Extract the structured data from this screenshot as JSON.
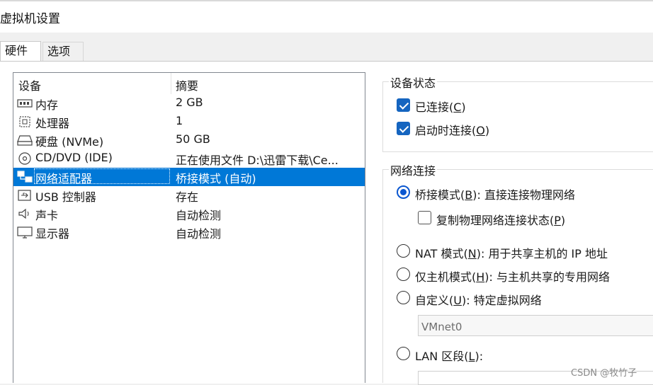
{
  "window": {
    "title": "虚拟机设置"
  },
  "tabs": [
    {
      "label": "硬件"
    },
    {
      "label": "选项"
    }
  ],
  "device_list": {
    "headers": {
      "device": "设备",
      "summary": "摘要"
    },
    "rows": [
      {
        "icon": "memory-icon",
        "name": "内存",
        "summary": "2 GB"
      },
      {
        "icon": "processor-icon",
        "name": "处理器",
        "summary": "1"
      },
      {
        "icon": "hard-disk-icon",
        "name": "硬盘 (NVMe)",
        "summary": "50 GB"
      },
      {
        "icon": "cd-dvd-icon",
        "name": "CD/DVD (IDE)",
        "summary": "正在使用文件 D:\\迅雷下载\\Ce..."
      },
      {
        "icon": "network-adapter-icon",
        "name": "网络适配器",
        "summary": "桥接模式 (自动)",
        "selected": true
      },
      {
        "icon": "usb-icon",
        "name": "USB 控制器",
        "summary": "存在"
      },
      {
        "icon": "sound-icon",
        "name": "声卡",
        "summary": "自动检测"
      },
      {
        "icon": "display-icon",
        "name": "显示器",
        "summary": "自动检测"
      }
    ]
  },
  "device_status": {
    "title": "设备状态",
    "connected": {
      "label_pre": "已连接(",
      "key": "C",
      "label_post": ")",
      "checked": true
    },
    "connect_at_power_on": {
      "label_pre": "启动时连接(",
      "key": "O",
      "label_post": ")",
      "checked": true
    }
  },
  "network_connection": {
    "title": "网络连接",
    "bridged": {
      "label_pre": "桥接模式(",
      "key": "B",
      "label_post": "): 直接连接物理网络",
      "selected": true
    },
    "replicate": {
      "label_pre": "复制物理网络连接状态(",
      "key": "P",
      "label_post": ")",
      "checked": false
    },
    "nat": {
      "label_pre": "NAT 模式(",
      "key": "N",
      "label_post": "): 用于共享主机的 IP 地址",
      "selected": false
    },
    "host_only": {
      "label_pre": "仅主机模式(",
      "key": "H",
      "label_post": "): 与主机共享的专用网络",
      "selected": false
    },
    "custom": {
      "label_pre": "自定义(",
      "key": "U",
      "label_post": "): 特定虚拟网络",
      "selected": false
    },
    "custom_network_value": "VMnet0",
    "lan_segment": {
      "label_pre": "LAN 区段(",
      "key": "L",
      "label_post": "):",
      "selected": false
    }
  },
  "watermark": "CSDN @牧竹子",
  "colors": {
    "selection": "#0078d7",
    "checkbox": "#1565c0",
    "radio": "#0b57d0"
  }
}
